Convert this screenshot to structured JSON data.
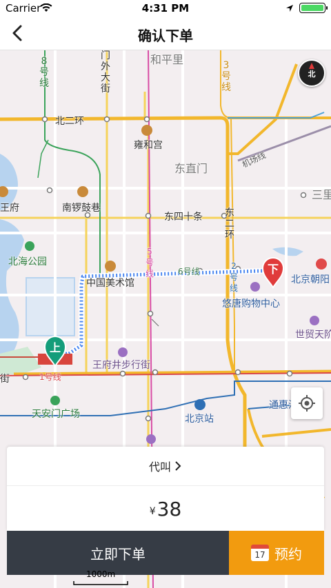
{
  "status_bar": {
    "carrier": "Carrier",
    "time": "4:31 PM",
    "battery_level": 1.0
  },
  "nav": {
    "title": "确认下单"
  },
  "map": {
    "labels": {
      "line8": "8号线",
      "menwai": "门外大街",
      "hepingli": "和平里",
      "line13": "3号线",
      "beierhuan": "北二环",
      "yonghegong": "雍和宫",
      "dongzhimen": "东直门",
      "airport": "机场线",
      "wangfu": "王府",
      "nanluoguxiang": "南锣鼓巷",
      "sanli": "三里",
      "dongsishitiao": "东四十条",
      "dongerhuan": "东二环",
      "beihai": "北海公园",
      "line5": "5号线",
      "nationalart": "中国美术馆",
      "line6": "6号线",
      "line2": "2号线",
      "chaoyang": "北京朝阳",
      "youtang": "悠唐购物中心",
      "shimao": "世贸天阶",
      "wangfujing": "王府井步行街",
      "jie": "街",
      "line1": "1号线",
      "tiananmen": "天安门广场",
      "beijingzhan": "北京站",
      "tonghui": "通惠河"
    },
    "pickup_marker": "上",
    "dropoff_marker": "下",
    "compass_label": "北",
    "scale": "1000m"
  },
  "order": {
    "proxy_label": "代叫",
    "currency": "¥",
    "price": "38"
  },
  "actions": {
    "order_now": "立即下单",
    "reserve": "预约",
    "reserve_icon_day": "17"
  },
  "colors": {
    "route": "#4a86f0",
    "pickup": "#159d7a",
    "dropoff": "#e03b3b",
    "order_button": "#363c45",
    "reserve_button": "#f29b0f"
  }
}
